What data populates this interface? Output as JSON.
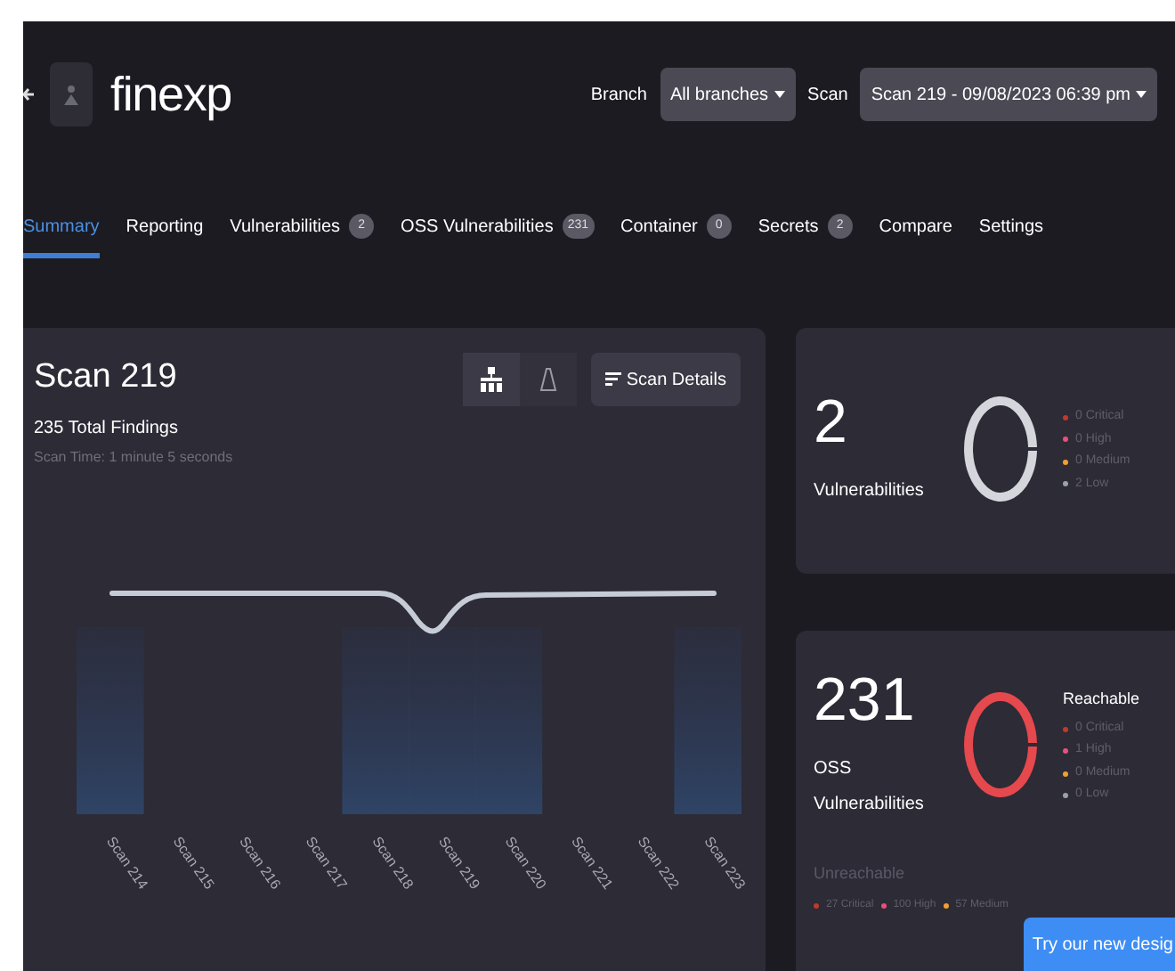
{
  "project": {
    "name": "finexp"
  },
  "filters": [
    {
      "label": "Branch",
      "value": "All branches"
    },
    {
      "label": "Scan",
      "value": "Scan 219 - 09/08/2023 06:39 pm"
    }
  ],
  "tabs": [
    {
      "label": "Summary",
      "selected": true
    },
    {
      "label": "Reporting",
      "selected": false
    },
    {
      "label": "Vulnerabilities",
      "count": "2",
      "selected": false
    },
    {
      "label": "OSS Vulnerabilities",
      "count": "231",
      "selected": false
    },
    {
      "label": "Container",
      "count": "0",
      "selected": false
    },
    {
      "label": "Secrets",
      "count": "2",
      "selected": false
    },
    {
      "label": "Compare",
      "selected": false
    },
    {
      "label": "Settings",
      "selected": false
    }
  ],
  "scan": {
    "title": "Scan 219",
    "findings": "235 Total Findings",
    "time": "Scan Time: 1 minute 5 seconds",
    "view_toggle": [
      {
        "selected": true
      },
      {
        "selected": false
      }
    ],
    "details_button": "Scan Details"
  },
  "chart_columns": [
    {
      "label": "Scan 214",
      "shaded": true
    },
    {
      "label": "Scan 215",
      "shaded": false
    },
    {
      "label": "Scan 216",
      "shaded": false
    },
    {
      "label": "Scan 217",
      "shaded": false
    },
    {
      "label": "Scan 218",
      "shaded": true
    },
    {
      "label": "Scan 219",
      "shaded": true
    },
    {
      "label": "Scan 220",
      "shaded": true
    },
    {
      "label": "Scan 221",
      "shaded": false
    },
    {
      "label": "Scan 222",
      "shaded": false
    },
    {
      "label": "Scan 223",
      "shaded": true
    }
  ],
  "summary_cards": [
    {
      "count": "2",
      "label": "Vulnerabilities",
      "color": "#d4d6dc",
      "legend": [
        {
          "label": "0 Critical",
          "color": "#c0392b"
        },
        {
          "label": "0 High",
          "color": "#e8507a"
        },
        {
          "label": "0 Medium",
          "color": "#f0a030"
        },
        {
          "label": "2 Low",
          "color": "#9aa0ad"
        }
      ]
    },
    {
      "count": "231",
      "label": "OSS Vulnerabilities",
      "color": "#e5484d",
      "legend_title": "Reachable",
      "legend": [
        {
          "label": "0 Critical",
          "color": "#c0392b"
        },
        {
          "label": "1 High",
          "color": "#e8507a"
        },
        {
          "label": "0 Medium",
          "color": "#f0a030"
        },
        {
          "label": "0 Low",
          "color": "#9aa0ad"
        }
      ],
      "unreachable_title": "Unreachable",
      "unreachable": [
        {
          "label": "27 Critical",
          "color": "#c0392b"
        },
        {
          "label": "100 High",
          "color": "#e8507a"
        },
        {
          "label": "57 Medium",
          "color": "#f0a030"
        }
      ]
    }
  ],
  "promo_button": "Try our new desig"
}
